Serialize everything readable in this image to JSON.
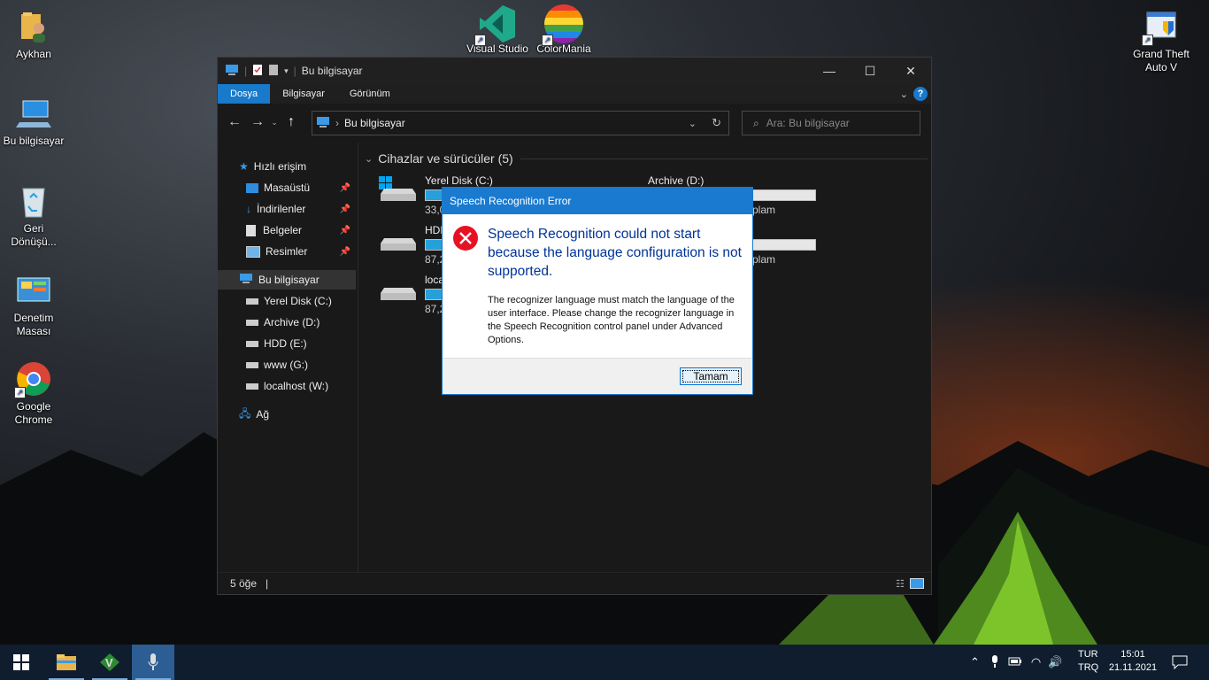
{
  "desktop": {
    "icons": [
      {
        "label": "Aykhan"
      },
      {
        "label": "Bu bilgisayar"
      },
      {
        "label": "Geri Dönüşü..."
      },
      {
        "label": "Denetim Masası"
      },
      {
        "label": "Google Chrome"
      },
      {
        "label": "Visual Studio"
      },
      {
        "label": "ColorMania"
      },
      {
        "label": "Grand Theft Auto V"
      }
    ]
  },
  "explorer": {
    "title": "Bu bilgisayar",
    "ribbon_tabs": [
      "Dosya",
      "Bilgisayar",
      "Görünüm"
    ],
    "address": "Bu bilgisayar",
    "search_placeholder": "Ara: Bu bilgisayar",
    "nav": {
      "quick_access": "Hızlı erişim",
      "quick_items": [
        "Masaüstü",
        "İndirilenler",
        "Belgeler",
        "Resimler"
      ],
      "this_pc": "Bu bilgisayar",
      "drives": [
        "Yerel Disk (C:)",
        "Archive (D:)",
        "HDD (E:)",
        "www (G:)",
        "localhost (W:)"
      ],
      "network": "Ağ"
    },
    "group_header": "Cihazlar ve sürücüler (5)",
    "drives": [
      {
        "name": "Yerel Disk (C:)",
        "sub": "33,0",
        "fill": 0.45
      },
      {
        "name": "Archive (D:)",
        "sub": "plam",
        "fill": 0.3
      },
      {
        "name": "HDD",
        "sub": "87,2",
        "fill": 0.55
      },
      {
        "name": "",
        "sub": "plam",
        "fill": 0.45
      },
      {
        "name": "loca",
        "sub": "87,2",
        "fill": 0.5
      }
    ],
    "status": "5 öğe"
  },
  "dialog": {
    "title": "Speech Recognition Error",
    "main_instruction": "Speech Recognition could not start because the language configuration is not supported.",
    "body": "The recognizer language must match the language of the user interface.  Please change the recognizer language in the Speech Recognition control panel under Advanced Options.",
    "ok_label": "Tamam"
  },
  "taskbar": {
    "lang_line1": "TUR",
    "lang_line2": "TRQ",
    "time": "15:01",
    "date": "21.11.2021"
  },
  "colors": {
    "accent": "#1979ca",
    "taskbar": "#0f1d2e",
    "window_bg": "#191919",
    "error_red": "#e81123"
  }
}
